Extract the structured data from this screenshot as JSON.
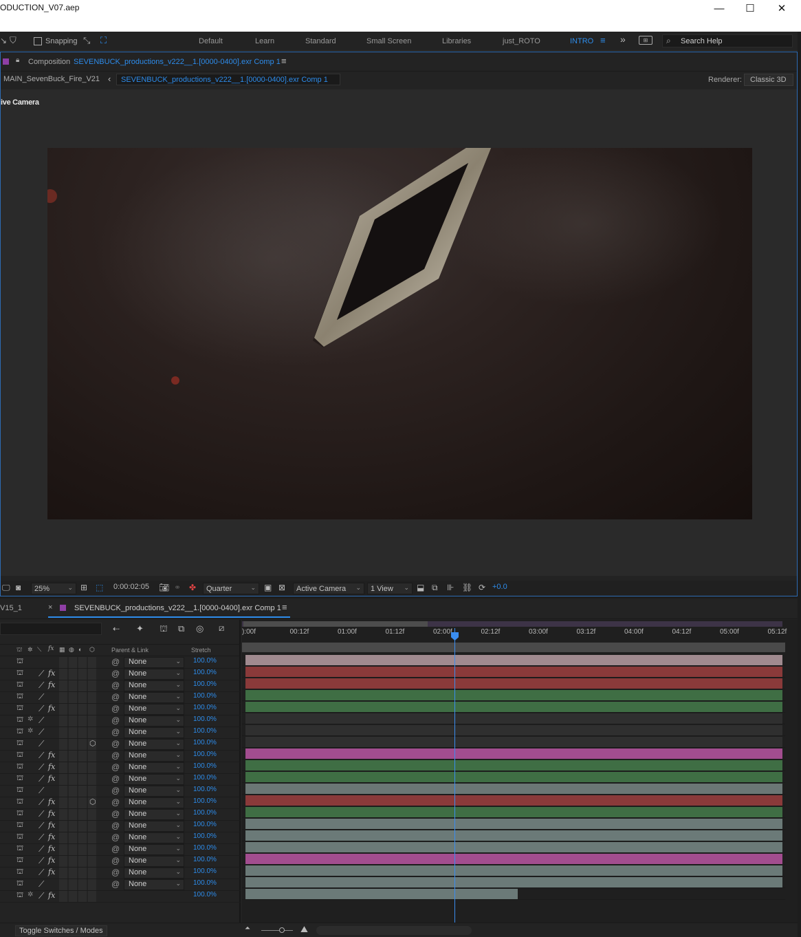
{
  "window": {
    "title": "ODUCTION_V07.aep",
    "controls": {
      "minimize": "—",
      "maximize": "☐",
      "close": "✕"
    }
  },
  "toolbar": {
    "snapping_label": "Snapping",
    "workspaces": [
      "Default",
      "Learn",
      "Standard",
      "Small Screen",
      "Libraries",
      "just_ROTO",
      "INTRO"
    ],
    "active_workspace": "INTRO",
    "search_placeholder": "Search Help"
  },
  "composition": {
    "panel_prefix": "Composition",
    "panel_name": "SEVENBUCK_productions_v222__1.[0000-0400].exr Comp 1",
    "breadcrumb_parent": "MAIN_SevenBuck_Fire_V21",
    "breadcrumb_current": "SEVENBUCK_productions_v222__1.[0000-0400].exr Comp 1",
    "renderer_label": "Renderer:",
    "renderer_value": "Classic 3D",
    "camera_overlay": "ive Camera"
  },
  "viewer_controls": {
    "zoom": "25%",
    "timecode": "0:00:02:05",
    "resolution": "Quarter",
    "view": "Active Camera",
    "layout": "1 View",
    "exposure": "+0.0"
  },
  "timeline": {
    "tab_left": "V15_1",
    "tab_name": "SEVENBUCK_productions_v222__1.[0000-0400].exr Comp 1",
    "columns": {
      "parent": "Parent & Link",
      "stretch": "Stretch"
    },
    "ruler_ticks": [
      "):00f",
      "00:12f",
      "01:00f",
      "01:12f",
      "02:00f",
      "02:12f",
      "03:00f",
      "03:12f",
      "04:00f",
      "04:12f",
      "05:00f",
      "05:12f"
    ],
    "current_time_fraction": 0.387,
    "layers": [
      {
        "pen": false,
        "fx": false,
        "sun": false,
        "cube": false,
        "parent": "None",
        "stretch": "100.0%",
        "color": "#a08a8f",
        "end": 1.0
      },
      {
        "pen": true,
        "fx": true,
        "sun": false,
        "cube": false,
        "parent": "None",
        "stretch": "100.0%",
        "color": "#8a3a3a",
        "end": 1.0
      },
      {
        "pen": true,
        "fx": true,
        "sun": false,
        "cube": false,
        "parent": "None",
        "stretch": "100.0%",
        "color": "#8a3a3a",
        "end": 1.0
      },
      {
        "pen": true,
        "fx": false,
        "sun": false,
        "cube": false,
        "parent": "None",
        "stretch": "100.0%",
        "color": "#3f6e44",
        "end": 1.0
      },
      {
        "pen": true,
        "fx": true,
        "sun": false,
        "cube": false,
        "parent": "None",
        "stretch": "100.0%",
        "color": "#3f6e44",
        "end": 1.0
      },
      {
        "pen": true,
        "fx": false,
        "sun": true,
        "cube": false,
        "parent": "None",
        "stretch": "100.0%",
        "color": "#2f2f2f",
        "end": 1.0
      },
      {
        "pen": true,
        "fx": false,
        "sun": true,
        "cube": false,
        "parent": "None",
        "stretch": "100.0%",
        "color": "#2f2f2f",
        "end": 1.0
      },
      {
        "pen": true,
        "fx": false,
        "sun": false,
        "cube": true,
        "parent": "None",
        "stretch": "100.0%",
        "color": "#2f2f2f",
        "end": 1.0
      },
      {
        "pen": true,
        "fx": true,
        "sun": false,
        "cube": false,
        "parent": "None",
        "stretch": "100.0%",
        "color": "#a24d8f",
        "end": 1.0
      },
      {
        "pen": true,
        "fx": true,
        "sun": false,
        "cube": false,
        "parent": "None",
        "stretch": "100.0%",
        "color": "#3f6e44",
        "end": 1.0
      },
      {
        "pen": true,
        "fx": true,
        "sun": false,
        "cube": false,
        "parent": "None",
        "stretch": "100.0%",
        "color": "#3f6e44",
        "end": 1.0
      },
      {
        "pen": true,
        "fx": false,
        "sun": false,
        "cube": false,
        "parent": "None",
        "stretch": "100.0%",
        "color": "#6b7775",
        "end": 1.0
      },
      {
        "pen": true,
        "fx": true,
        "sun": false,
        "cube": true,
        "parent": "None",
        "stretch": "100.0%",
        "color": "#8a3a3a",
        "end": 1.0
      },
      {
        "pen": true,
        "fx": true,
        "sun": false,
        "cube": false,
        "parent": "None",
        "stretch": "100.0%",
        "color": "#3f6e44",
        "end": 1.0
      },
      {
        "pen": true,
        "fx": true,
        "sun": false,
        "cube": false,
        "parent": "None",
        "stretch": "100.0%",
        "color": "#6b7a78",
        "end": 1.0
      },
      {
        "pen": true,
        "fx": true,
        "sun": false,
        "cube": false,
        "parent": "None",
        "stretch": "100.0%",
        "color": "#6b7a78",
        "end": 1.0
      },
      {
        "pen": true,
        "fx": true,
        "sun": false,
        "cube": false,
        "parent": "None",
        "stretch": "100.0%",
        "color": "#6b7a78",
        "end": 1.0
      },
      {
        "pen": true,
        "fx": true,
        "sun": false,
        "cube": false,
        "parent": "None",
        "stretch": "100.0%",
        "color": "#a24d8f",
        "end": 1.0
      },
      {
        "pen": true,
        "fx": true,
        "sun": false,
        "cube": false,
        "parent": "None",
        "stretch": "100.0%",
        "color": "#6b7a78",
        "end": 1.0
      },
      {
        "pen": true,
        "fx": false,
        "sun": false,
        "cube": false,
        "parent": "None",
        "stretch": "100.0%",
        "color": "#6b7a78",
        "end": 1.0
      },
      {
        "pen": true,
        "fx": true,
        "sun": true,
        "cube": false,
        "parent": null,
        "stretch": "100.0%",
        "color": "#6b7a78",
        "end": 0.51
      }
    ],
    "toggle_label": "Toggle Switches / Modes"
  }
}
